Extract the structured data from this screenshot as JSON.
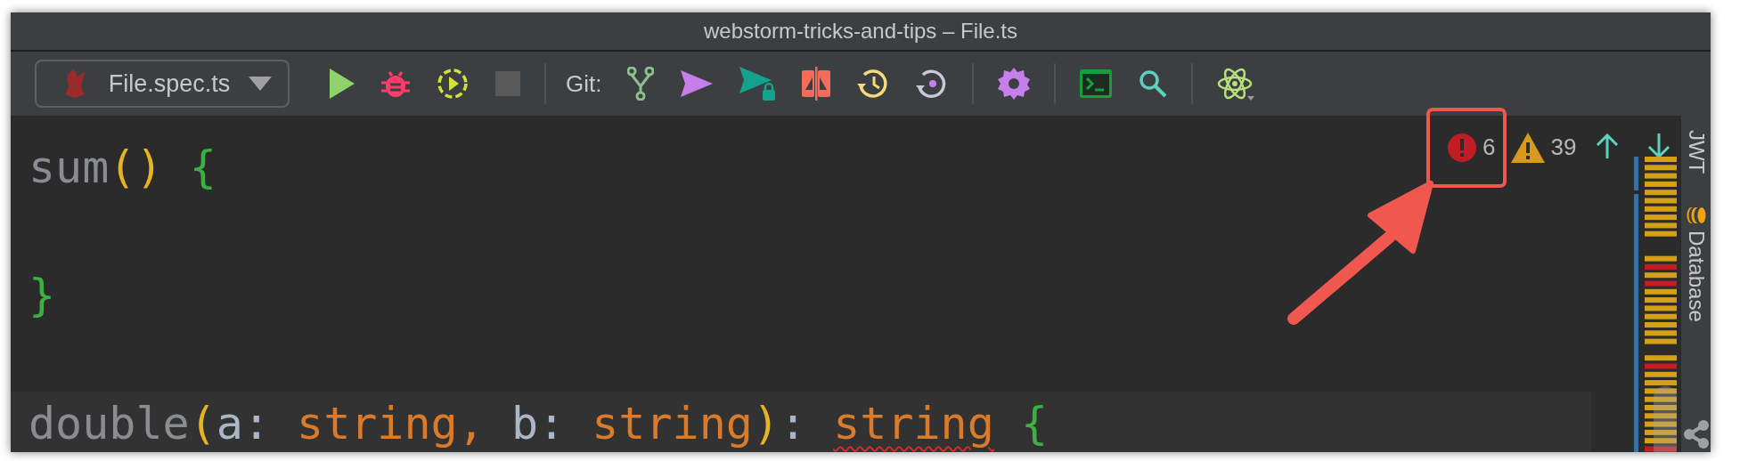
{
  "window": {
    "title": "webstorm-tricks-and-tips – File.ts"
  },
  "toolbar": {
    "run_configuration": "File.spec.ts",
    "git_label": "Git:"
  },
  "editor": {
    "lines": [
      {
        "current": false,
        "tokens": [
          {
            "text": "sum",
            "kind": "name"
          },
          {
            "text": "()",
            "kind": "paren"
          },
          {
            "text": " {",
            "kind": "brace"
          }
        ]
      },
      {
        "current": false,
        "tokens": [
          {
            "text": "}",
            "kind": "brace"
          }
        ]
      },
      {
        "current": true,
        "tokens": [
          {
            "text": "double",
            "kind": "name"
          },
          {
            "text": "(",
            "kind": "paren"
          },
          {
            "text": "a",
            "kind": "param"
          },
          {
            "text": ": ",
            "kind": "punct"
          },
          {
            "text": "string",
            "kind": "type"
          },
          {
            "text": ",",
            "kind": "type"
          },
          {
            "text": " b",
            "kind": "param"
          },
          {
            "text": ": ",
            "kind": "punct"
          },
          {
            "text": "string",
            "kind": "type"
          },
          {
            "text": ")",
            "kind": "paren"
          },
          {
            "text": ": ",
            "kind": "punct"
          },
          {
            "text": "string",
            "kind": "type",
            "error": true
          },
          {
            "text": " {",
            "kind": "brace"
          }
        ]
      }
    ],
    "inspections": {
      "errors": "6",
      "warnings": "39"
    }
  },
  "sidebar": {
    "tabs": [
      "JWT",
      "Database"
    ]
  }
}
